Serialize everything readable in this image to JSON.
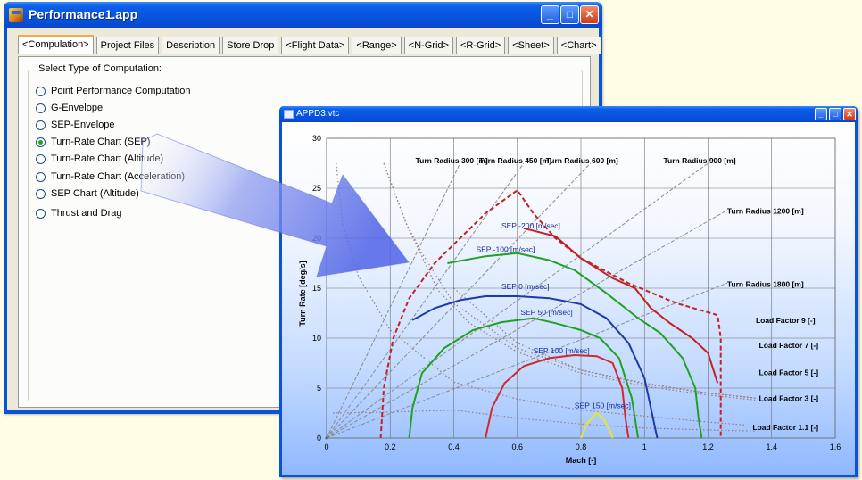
{
  "main_window": {
    "title": "Performance1.app",
    "minimize_glyph": "_",
    "maximize_glyph": "□",
    "close_glyph": "✕",
    "tabs": [
      {
        "label": "<Compulation>",
        "active": true
      },
      {
        "label": "Project Files"
      },
      {
        "label": "Description"
      },
      {
        "label": "Store Drop"
      },
      {
        "label": "<Flight Data>"
      },
      {
        "label": "<Range>"
      },
      {
        "label": "<N-Grid>"
      },
      {
        "label": "<R-Grid>"
      },
      {
        "label": "<Sheet>"
      },
      {
        "label": "<Chart>"
      }
    ],
    "group_label": "Select Type of Computation:",
    "options": [
      {
        "label": "Point Performance Computation",
        "checked": false
      },
      {
        "label": "G-Envelope",
        "checked": false
      },
      {
        "label": "SEP-Envelope",
        "checked": false
      },
      {
        "label": "Turn-Rate Chart (SEP)",
        "checked": true
      },
      {
        "label": "Turn-Rate Chart (Altitude)",
        "checked": false
      },
      {
        "label": "Turn-Rate Chart (Acceleration)",
        "checked": false
      },
      {
        "label": "SEP Chart (Altitude)",
        "checked": false
      },
      {
        "label": "Thrust and Drag",
        "checked": false
      }
    ]
  },
  "chart_window": {
    "title": "APPD3.vtc",
    "minimize_glyph": "_",
    "maximize_glyph": "□",
    "close_glyph": "✕"
  },
  "chart_data": {
    "type": "line",
    "title": "",
    "xlabel": "Mach [-]",
    "ylabel": "Turn Rate [deg/s]",
    "xlim": [
      0,
      1.6
    ],
    "ylim": [
      0,
      30
    ],
    "xticks": [
      0,
      0.2,
      0.4,
      0.6,
      0.8,
      1,
      1.2,
      1.4,
      1.6
    ],
    "yticks": [
      0,
      5,
      10,
      15,
      20,
      25,
      30
    ],
    "grid": true,
    "turn_radius_lines": [
      {
        "name": "Turn Radius 300 [m]",
        "end": [
          0.42,
          27.5
        ]
      },
      {
        "name": "Turn Radius 450 [m]",
        "end": [
          0.62,
          27.5
        ]
      },
      {
        "name": "Turn Radius 600 [m]",
        "end": [
          0.83,
          27.5
        ]
      },
      {
        "name": "Turn Radius 900 [m]",
        "end": [
          1.2,
          27.5
        ]
      },
      {
        "name": "Turn Radius 1200 [m]",
        "end": [
          1.26,
          22.8
        ]
      },
      {
        "name": "Turn Radius 1800 [m]",
        "end": [
          1.26,
          15.5
        ]
      }
    ],
    "load_factor_lines": [
      {
        "name": "Load Factor 9 [-]",
        "points": [
          [
            0.03,
            27.5
          ],
          [
            0.05,
            21.5
          ],
          [
            0.1,
            16.2
          ],
          [
            0.2,
            10.8
          ],
          [
            0.4,
            5.6
          ],
          [
            0.6,
            3.9
          ],
          [
            0.8,
            2.8
          ],
          [
            1.0,
            2.2
          ],
          [
            1.2,
            1.6
          ],
          [
            1.32,
            1.3
          ]
        ],
        "label_at": [
          1.35,
          11.5
        ]
      },
      {
        "name": "Load Factor 7 [-]",
        "points": [
          [
            0.18,
            27.5
          ],
          [
            0.25,
            21.5
          ],
          [
            0.3,
            18.5
          ],
          [
            0.4,
            13.5
          ],
          [
            0.6,
            9.0
          ],
          [
            0.8,
            6.8
          ],
          [
            1.0,
            5.5
          ],
          [
            1.2,
            4.5
          ],
          [
            1.35,
            4.0
          ]
        ],
        "label_at": [
          1.36,
          9.0
        ]
      },
      {
        "name": "Load Factor 5 [-]",
        "points": [
          [
            0.18,
            27.5
          ],
          [
            0.25,
            21.5
          ],
          [
            0.35,
            14.8
          ],
          [
            0.45,
            11.5
          ],
          [
            0.6,
            8.6
          ],
          [
            0.8,
            6.5
          ],
          [
            1.0,
            5.2
          ],
          [
            1.2,
            4.3
          ],
          [
            1.35,
            3.8
          ]
        ],
        "label_at": [
          1.36,
          6.3
        ]
      },
      {
        "name": "Load Factor 3 [-]",
        "points": [
          [
            0.4,
            15
          ],
          [
            0.6,
            9.5
          ],
          [
            0.8,
            6.8
          ],
          [
            1.0,
            5.4
          ],
          [
            1.2,
            4.5
          ],
          [
            1.35,
            4.0
          ]
        ],
        "label_at": [
          1.36,
          3.7
        ]
      },
      {
        "name": "Load Factor 1.1 [-]",
        "points": [
          [
            0.02,
            2.5
          ],
          [
            0.2,
            2.6
          ],
          [
            0.4,
            2.8
          ],
          [
            0.6,
            2.0
          ],
          [
            0.8,
            1.4
          ],
          [
            1.0,
            1.0
          ],
          [
            1.2,
            0.8
          ],
          [
            1.35,
            0.7
          ]
        ],
        "label_at": [
          1.34,
          0.8
        ]
      }
    ],
    "series": [
      {
        "name": "SEP -200 [m/sec]",
        "color": "#c42020",
        "dashed": true,
        "label_at": [
          0.55,
          21.0
        ],
        "points": [
          [
            0.17,
            0
          ],
          [
            0.18,
            5
          ],
          [
            0.21,
            10
          ],
          [
            0.26,
            14
          ],
          [
            0.34,
            17.5
          ],
          [
            0.42,
            20
          ],
          [
            0.5,
            22.5
          ],
          [
            0.6,
            24.8
          ],
          [
            0.65,
            22.5
          ],
          [
            0.72,
            20
          ],
          [
            0.8,
            18
          ],
          [
            0.95,
            15.5
          ],
          [
            1.1,
            13.5
          ],
          [
            1.23,
            12.3
          ],
          [
            1.24,
            10
          ],
          [
            1.24,
            5
          ],
          [
            1.24,
            0
          ]
        ]
      },
      {
        "name": "SEP -100 [m/sec]",
        "color": "#21a121",
        "dashed": false,
        "label_at": [
          0.47,
          18.6
        ],
        "points": [
          [
            0.38,
            17.5
          ],
          [
            0.5,
            18.2
          ],
          [
            0.6,
            18.5
          ],
          [
            0.7,
            17.8
          ],
          [
            0.78,
            16.8
          ],
          [
            0.88,
            14.5
          ],
          [
            0.98,
            12
          ],
          [
            1.05,
            10.5
          ],
          [
            1.12,
            8
          ],
          [
            1.16,
            5
          ],
          [
            1.17,
            2
          ],
          [
            1.18,
            0
          ]
        ]
      },
      {
        "name": "SEP 0 [m/sec]",
        "color": "#1e3aa8",
        "dashed": false,
        "label_at": [
          0.55,
          14.9
        ],
        "points": [
          [
            0.27,
            11.8
          ],
          [
            0.34,
            13.0
          ],
          [
            0.42,
            13.8
          ],
          [
            0.5,
            14.2
          ],
          [
            0.6,
            14.2
          ],
          [
            0.7,
            14.0
          ],
          [
            0.8,
            13.4
          ],
          [
            0.88,
            12.0
          ],
          [
            0.95,
            9.5
          ],
          [
            1.0,
            6
          ],
          [
            1.02,
            3
          ],
          [
            1.04,
            0
          ]
        ]
      },
      {
        "name": "SEP 50 [m/sec]",
        "color": "#21a121",
        "dashed": false,
        "label_at": [
          0.61,
          12.3
        ],
        "points": [
          [
            0.26,
            0
          ],
          [
            0.27,
            3
          ],
          [
            0.3,
            6.5
          ],
          [
            0.37,
            9
          ],
          [
            0.46,
            10.8
          ],
          [
            0.55,
            11.6
          ],
          [
            0.65,
            12.0
          ],
          [
            0.72,
            11.5
          ],
          [
            0.8,
            10.8
          ],
          [
            0.86,
            10.0
          ],
          [
            0.92,
            8
          ],
          [
            0.96,
            4
          ],
          [
            0.98,
            0
          ]
        ]
      },
      {
        "name": "SEP 100 [m/sec]",
        "color": "#d02a2a",
        "dashed": false,
        "label_at": [
          0.65,
          8.5
        ],
        "points": [
          [
            0.5,
            0
          ],
          [
            0.52,
            3
          ],
          [
            0.56,
            5.5
          ],
          [
            0.62,
            7.2
          ],
          [
            0.7,
            8.0
          ],
          [
            0.78,
            8.3
          ],
          [
            0.85,
            8.2
          ],
          [
            0.9,
            7.5
          ],
          [
            0.93,
            5
          ],
          [
            0.94,
            2
          ],
          [
            0.95,
            0
          ]
        ]
      },
      {
        "name": "SEP 150 [m/sec]",
        "color": "#e8e820",
        "dashed": false,
        "label_at": [
          0.78,
          3.0
        ],
        "points": [
          [
            0.8,
            0
          ],
          [
            0.82,
            1.5
          ],
          [
            0.85,
            2.5
          ],
          [
            0.87,
            2.0
          ],
          [
            0.89,
            0.8
          ],
          [
            0.9,
            0
          ]
        ]
      },
      {
        "name": "",
        "color": "#c42020",
        "dashed": false,
        "label_at": null,
        "points": [
          [
            0.62,
            21.0
          ],
          [
            0.72,
            20.2
          ],
          [
            0.8,
            18.0
          ],
          [
            0.9,
            16.0
          ],
          [
            0.97,
            15.0
          ],
          [
            1.02,
            13.0
          ],
          [
            1.08,
            11.5
          ],
          [
            1.15,
            10.0
          ],
          [
            1.2,
            8.5
          ],
          [
            1.23,
            5.5
          ]
        ]
      }
    ]
  }
}
